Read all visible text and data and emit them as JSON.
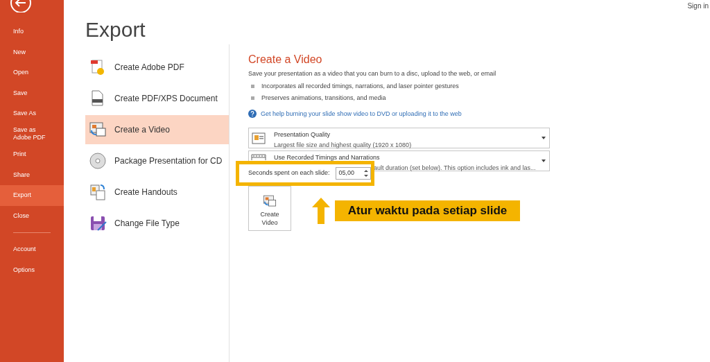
{
  "sidebar": {
    "items": [
      {
        "label": "Info",
        "selected": false
      },
      {
        "label": "New",
        "selected": false
      },
      {
        "label": "Open",
        "selected": false
      },
      {
        "label": "Save",
        "selected": false
      },
      {
        "label": "Save As",
        "selected": false
      },
      {
        "label": "Save as Adobe PDF",
        "selected": false
      },
      {
        "label": "Print",
        "selected": false
      },
      {
        "label": "Share",
        "selected": false
      },
      {
        "label": "Export",
        "selected": true
      },
      {
        "label": "Close",
        "selected": false
      },
      {
        "label": "Account",
        "selected": false
      },
      {
        "label": "Options",
        "selected": false
      }
    ]
  },
  "sign_in": "Sign in",
  "page_title": "Export",
  "export_options": [
    {
      "kind": "adobe-pdf",
      "label": "Create Adobe PDF",
      "selected": false
    },
    {
      "kind": "pdf-xps",
      "label": "Create PDF/XPS Document",
      "selected": false
    },
    {
      "kind": "video",
      "label": "Create a Video",
      "selected": true
    },
    {
      "kind": "cd",
      "label": "Package Presentation for CD",
      "selected": false
    },
    {
      "kind": "handouts",
      "label": "Create Handouts",
      "selected": false
    },
    {
      "kind": "file-type",
      "label": "Change File Type",
      "selected": false
    }
  ],
  "detail": {
    "title": "Create a Video",
    "description": "Save your presentation as a video that you can burn to a disc, upload to the web, or email",
    "bullets": [
      "Incorporates all recorded timings, narrations, and laser pointer gestures",
      "Preserves animations, transitions, and media"
    ],
    "help_link": "Get help burning your slide show video to DVD or uploading it to the web",
    "dropdowns": [
      {
        "kind": "quality",
        "title": "Presentation Quality",
        "description": "Largest file size and highest quality (1920 x 1080)"
      },
      {
        "kind": "timings",
        "title": "Use Recorded Timings and Narrations",
        "description": "ault duration (set below). This option includes ink and las..."
      }
    ],
    "seconds_label": "Seconds spent on each slide:",
    "seconds_value": "05,00",
    "create_button": "Create Video"
  },
  "annotation": {
    "text": "Atur waktu pada setiap slide"
  }
}
